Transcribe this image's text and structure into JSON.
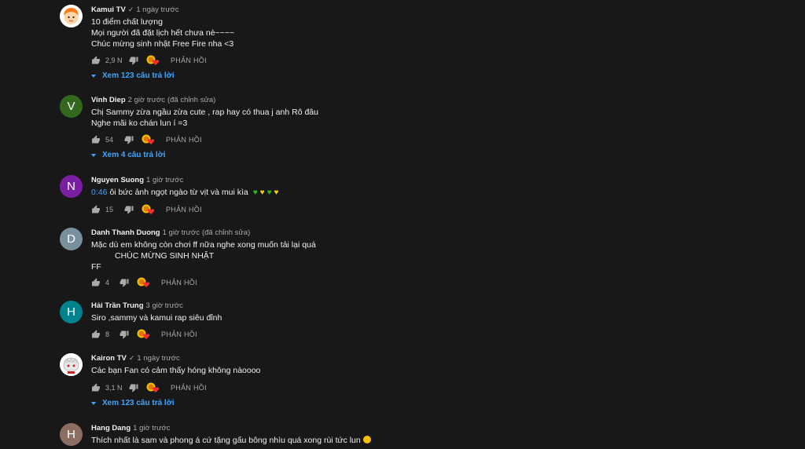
{
  "comments": [
    {
      "author": "Kamui TV",
      "verified": true,
      "time": "1 ngày trước",
      "edited": "",
      "avatar_letter": "",
      "avatar_color": "#ffffff",
      "lines": [
        "10 điểm chất lượng",
        "Mọi người đã đặt lịch hết chưa nè~~~~",
        "Chúc mừng sinh nhật Free Fire nha <3"
      ],
      "likes": "2,9 N",
      "reply_label": "PHẢN HỒI",
      "view_replies": "Xem 123 câu trả lời"
    },
    {
      "author": "Vinh Diep",
      "verified": false,
      "time": "2 giờ trước",
      "edited": "(đã chỉnh sửa)",
      "avatar_letter": "V",
      "avatar_color": "#33691e",
      "lines": [
        "Chị Sammy zừa ngầu zừa cute , rap hay có thua j anh Rô đâu",
        "Nghe mãi ko chán lun í  =3"
      ],
      "likes": "54",
      "reply_label": "PHẢN HỒI",
      "view_replies": "Xem 4 câu trả lời"
    },
    {
      "author": "Nguyen Suong",
      "verified": false,
      "time": "1 giờ trước",
      "edited": "",
      "avatar_letter": "N",
      "avatar_color": "#7b1fa2",
      "timestamp": "0:46",
      "lines": [
        "ôi bức ảnh ngọt ngào từ vịt và mui kìa"
      ],
      "likes": "15",
      "reply_label": "PHẢN HỒI",
      "view_replies": ""
    },
    {
      "author": "Danh Thanh Duong",
      "verified": false,
      "time": "1 giờ trước",
      "edited": "(đã chỉnh sửa)",
      "avatar_letter": "D",
      "avatar_color": "#78909c",
      "lines": [
        "Mặc dù em không còn chơi ff nữa nghe xong muốn tải lại quá",
        "CHÚC MỪNG SINH NHẬT",
        "FF"
      ],
      "likes": "4",
      "reply_label": "PHẢN HỒI",
      "view_replies": ""
    },
    {
      "author": "Hải Trần Trung",
      "verified": false,
      "time": "3 giờ trước",
      "edited": "",
      "avatar_letter": "H",
      "avatar_color": "#00838f",
      "lines": [
        "Siro ,sammy và kamui rap siêu đỉnh"
      ],
      "likes": "8",
      "reply_label": "PHẢN HỒI",
      "view_replies": ""
    },
    {
      "author": "Kairon TV",
      "verified": true,
      "time": "1 ngày trước",
      "edited": "",
      "avatar_letter": "",
      "avatar_color": "#ffffff",
      "lines": [
        "Các bạn Fan có cảm thấy hóng không nàoooo"
      ],
      "likes": "3,1 N",
      "reply_label": "PHẢN HỒI",
      "view_replies": "Xem 123 câu trả lời"
    },
    {
      "author": "Hang Dang",
      "verified": false,
      "time": "1 giờ trước",
      "edited": "",
      "avatar_letter": "H",
      "avatar_color": "#8d6e63",
      "lines": [
        "Thích nhất là sam và phong á cứ tặng gấu bông nhìu quá xong rùi tức lun"
      ],
      "likes": "",
      "reply_label": "",
      "view_replies": ""
    }
  ],
  "colors": {
    "background": "#181818",
    "link": "#3ea6ff",
    "secondary_text": "#aaaaaa"
  },
  "icons": [
    "like-icon",
    "dislike-icon",
    "creator-heart-icon",
    "chevron-down-icon",
    "verified-icon"
  ]
}
